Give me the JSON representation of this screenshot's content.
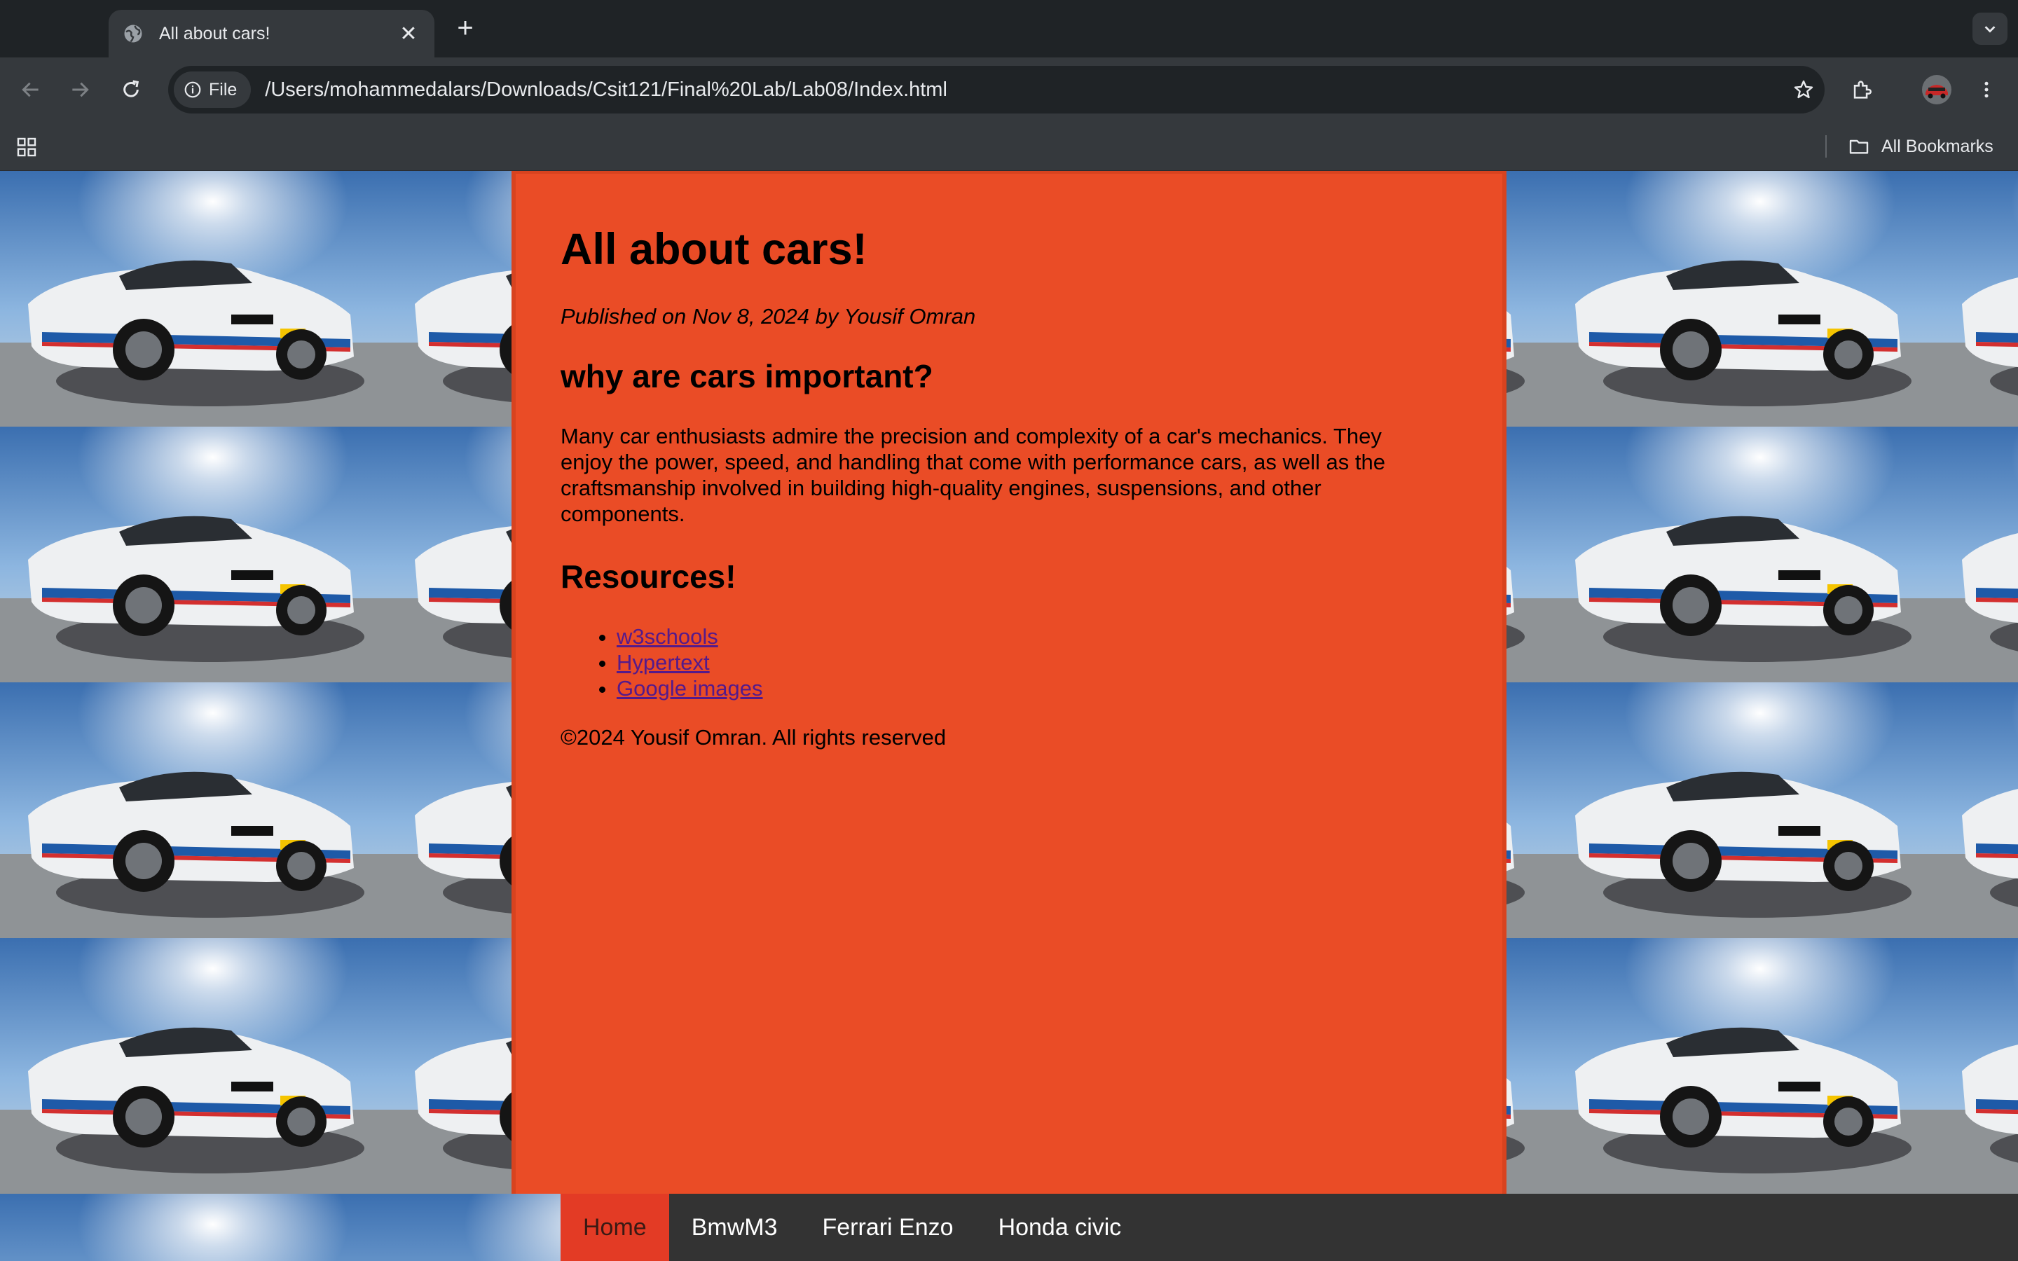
{
  "browser": {
    "tab_title": "All about cars!",
    "address_chip": "File",
    "url": "/Users/mohammedalars/Downloads/Csit121/Final%20Lab/Lab08/Index.html",
    "all_bookmarks": "All Bookmarks"
  },
  "page": {
    "title": "All about cars!",
    "published": "Published on Nov 8, 2024 by Yousif Omran",
    "subheading": "why are cars important?",
    "paragraph": "Many car enthusiasts admire the precision and complexity of a car's mechanics. They enjoy the power, speed, and handling that come with performance cars, as well as the craftsmanship involved in building high-quality engines, suspensions, and other components.",
    "resources_heading": "Resources!",
    "resources": [
      "w3schools",
      "Hypertext",
      "Google images"
    ],
    "footer": "©2024 Yousif Omran. All rights reserved"
  },
  "nav": [
    "Home",
    "BmwM3",
    "Ferrari Enzo",
    "Honda civic"
  ],
  "colors": {
    "card_bg": "#ea4c26",
    "nav_bg": "#333333",
    "nav_active": "#e33b25",
    "link": "#551a8b"
  }
}
